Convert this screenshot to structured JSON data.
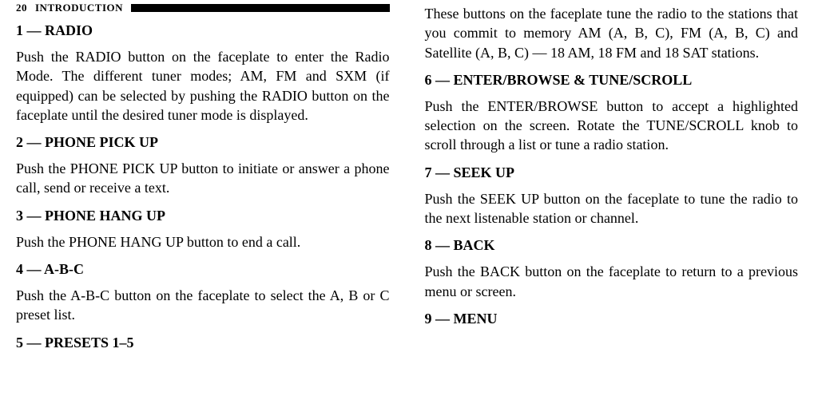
{
  "header": {
    "page_number": "20",
    "section": "INTRODUCTION"
  },
  "left": {
    "h1": "1 — RADIO",
    "p1": "Push the RADIO button on the faceplate to enter the Radio Mode. The different tuner modes; AM, FM and SXM (if equipped) can be selected by pushing the RADIO button on the faceplate until the desired tuner mode is displayed.",
    "h2": "2 — PHONE PICK UP",
    "p2": "Push the PHONE PICK UP button to initiate or answer a phone call, send or receive a text.",
    "h3": "3 — PHONE HANG UP",
    "p3": "Push the PHONE HANG UP button to end a call.",
    "h4": "4 — A-B-C",
    "p4": "Push the A-B-C button on the faceplate to select the A, B or C preset list.",
    "h5": "5 — PRESETS 1–5"
  },
  "right": {
    "p0": "These buttons on the faceplate tune the radio to the stations that you commit to memory AM (A, B, C), FM (A, B, C) and Satellite (A, B, C) — 18 AM, 18 FM and 18 SAT stations.",
    "h6": "6 — ENTER/BROWSE & TUNE/SCROLL",
    "p6": "Push the ENTER/BROWSE button to accept a high­lighted selection on the screen. Rotate the TUNE/SCROLL knob to scroll through a list or tune a radio station.",
    "h7": "7 — SEEK UP",
    "p7": "Push the SEEK UP button on the faceplate to tune the radio to the next listenable station or channel.",
    "h8": "8 — BACK",
    "p8": "Push the BACK button on the faceplate to return to a previous menu or screen.",
    "h9": "9 — MENU"
  }
}
